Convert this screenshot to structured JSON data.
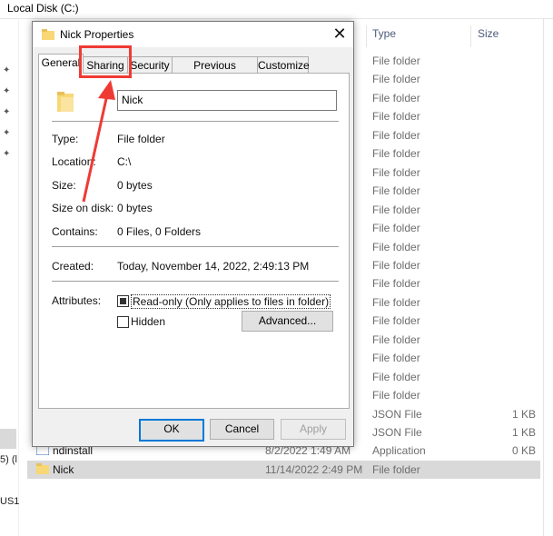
{
  "window_title": "Local Disk (C:)",
  "columns": {
    "type": "Type",
    "size": "Size"
  },
  "sidebar": {
    "text1": "5) (l",
    "text2": "US1"
  },
  "file_rows": [
    {
      "name": "",
      "date": "",
      "type": "File folder",
      "size": ""
    },
    {
      "name": "",
      "date": "",
      "type": "File folder",
      "size": ""
    },
    {
      "name": "",
      "date": "",
      "type": "File folder",
      "size": ""
    },
    {
      "name": "",
      "date": "",
      "type": "File folder",
      "size": ""
    },
    {
      "name": "",
      "date": "",
      "type": "File folder",
      "size": ""
    },
    {
      "name": "",
      "date": "",
      "type": "File folder",
      "size": ""
    },
    {
      "name": "",
      "date": "",
      "type": "File folder",
      "size": ""
    },
    {
      "name": "",
      "date": "",
      "type": "File folder",
      "size": ""
    },
    {
      "name": "",
      "date": "",
      "type": "File folder",
      "size": ""
    },
    {
      "name": "",
      "date": "",
      "type": "File folder",
      "size": ""
    },
    {
      "name": "",
      "date": "",
      "type": "File folder",
      "size": ""
    },
    {
      "name": "",
      "date": "",
      "type": "File folder",
      "size": ""
    },
    {
      "name": "",
      "date": "",
      "type": "File folder",
      "size": ""
    },
    {
      "name": "",
      "date": "",
      "type": "File folder",
      "size": ""
    },
    {
      "name": "",
      "date": "",
      "type": "File folder",
      "size": ""
    },
    {
      "name": "",
      "date": "",
      "type": "File folder",
      "size": ""
    },
    {
      "name": "",
      "date": "",
      "type": "File folder",
      "size": ""
    },
    {
      "name": "",
      "date": "",
      "type": "File folder",
      "size": ""
    },
    {
      "name": "",
      "date": "",
      "type": "File folder",
      "size": ""
    },
    {
      "name": "",
      "date": "",
      "type": "JSON File",
      "size": "1 KB"
    },
    {
      "name": "",
      "date": "",
      "type": "JSON File",
      "size": "1 KB"
    },
    {
      "name": "ndinstall",
      "date": "8/2/2022 1:49 AM",
      "type": "Application",
      "size": "0 KB"
    },
    {
      "name": "Nick",
      "date": "11/14/2022 2:49 PM",
      "type": "File folder",
      "size": ""
    }
  ],
  "dialog": {
    "title": "Nick Properties",
    "close_glyph": "✕",
    "tabs": [
      "General",
      "Sharing",
      "Security",
      "Previous Versions",
      "Customize"
    ],
    "folder_name": "Nick",
    "type_label": "Type:",
    "type_value": "File folder",
    "location_label": "Location:",
    "location_value": "C:\\",
    "size_label": "Size:",
    "size_value": "0 bytes",
    "size_on_disk_label": "Size on disk:",
    "size_on_disk_value": "0 bytes",
    "contains_label": "Contains:",
    "contains_value": "0 Files, 0 Folders",
    "created_label": "Created:",
    "created_value": "Today, November 14, 2022, 2:49:13 PM",
    "attributes_label": "Attributes:",
    "readonly_label": "Read-only (Only applies to files in folder)",
    "hidden_label": "Hidden",
    "advanced_label": "Advanced...",
    "ok_label": "OK",
    "cancel_label": "Cancel",
    "apply_label": "Apply"
  },
  "colors": {
    "highlight": "#ef3a34",
    "folder": "#f8d775",
    "accent": "#0078d7"
  }
}
